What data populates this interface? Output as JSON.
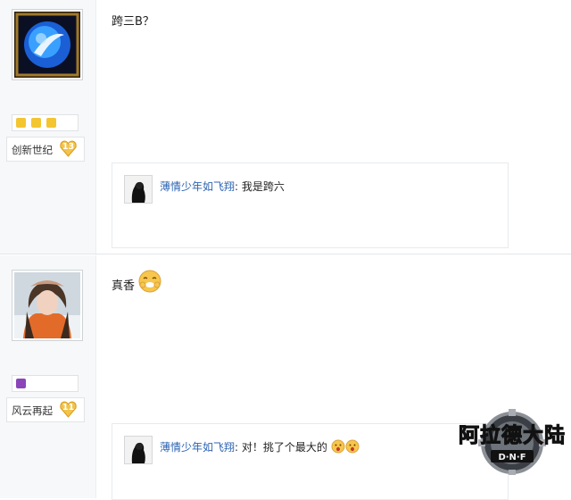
{
  "posts": [
    {
      "content": "跨三B？",
      "username": "创新世纪",
      "level": "13",
      "reply": {
        "user": "薄情少年如飞翔",
        "sep": ":",
        "text": "我是跨六"
      }
    },
    {
      "content": "真香",
      "username": "风云再起",
      "level": "11",
      "reply": {
        "user": "薄情少年如飞翔",
        "sep": ":",
        "text": "对！挑了个最大的"
      }
    }
  ],
  "watermark": {
    "title": "阿拉德大陆",
    "sub": "D·N·F"
  },
  "colors": {
    "link": "#2d64b3",
    "level_heart": "#f3c34a",
    "sidebar_bg": "#f7f8f9"
  },
  "icons": [
    "blue-orb-avatar-icon",
    "portrait-avatar-icon",
    "level-heart-icon",
    "laugh-emoji-icon",
    "silhouette-avatar-icon"
  ]
}
